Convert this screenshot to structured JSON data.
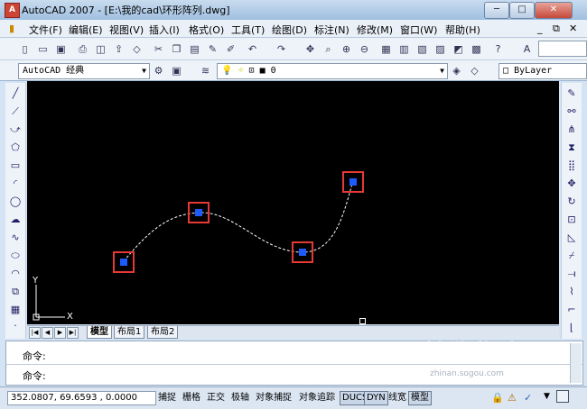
{
  "title_bar": {
    "title": "AutoCAD 2007 - [E:\\我的cad\\环形阵列.dwg]",
    "app_icon": "A",
    "controls": [
      "minimize-icon",
      "maximize-icon",
      "close-icon"
    ]
  },
  "menu": {
    "items": [
      "文件(F)",
      "编辑(E)",
      "视图(V)",
      "插入(I)",
      "格式(O)",
      "工具(T)",
      "绘图(D)",
      "标注(N)",
      "修改(M)",
      "窗口(W)",
      "帮助(H)"
    ],
    "doc_controls": [
      "minimize-icon",
      "restore-icon",
      "close-icon"
    ]
  },
  "toolbar2": {
    "workspace": "AutoCAD 经典",
    "layer": "0",
    "color": "ByLayer"
  },
  "layout_tabs": [
    "模型",
    "布局1",
    "布局2"
  ],
  "command": {
    "line1": "命令:",
    "line2": "命令:"
  },
  "watermark": {
    "text": "搜狗指南",
    "sub": "zhinan.sogou.com"
  },
  "status": {
    "coords": "352.0807, 69.6593 , 0.0000",
    "toggles": [
      {
        "label": "捕捉",
        "on": false
      },
      {
        "label": "栅格",
        "on": false
      },
      {
        "label": "正交",
        "on": false
      },
      {
        "label": "极轴",
        "on": false
      },
      {
        "label": "对象捕捉",
        "on": false
      },
      {
        "label": "对象追踪",
        "on": false
      },
      {
        "label": "DUCS",
        "on": true
      },
      {
        "label": "DYN",
        "on": true
      },
      {
        "label": "线宽",
        "on": false
      },
      {
        "label": "模型",
        "on": true
      }
    ]
  },
  "ucs": {
    "x": "X",
    "y": "Y"
  },
  "colors": {
    "canvas": "#000000",
    "grip_box": "#e53935",
    "grip_fill": "#1e5bff",
    "curve": "#ffffff"
  }
}
